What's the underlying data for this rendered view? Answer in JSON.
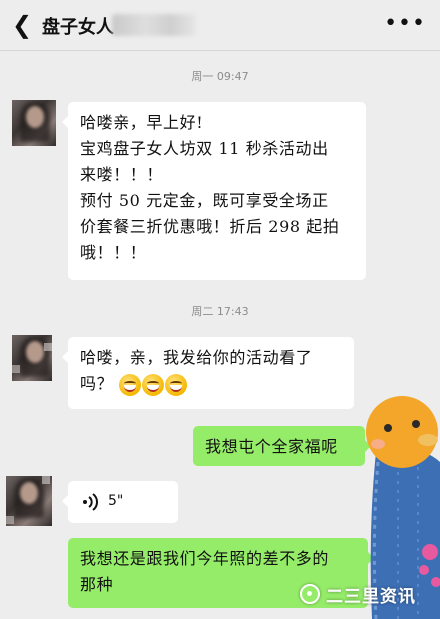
{
  "header": {
    "back_icon": "chevron-left-icon",
    "title": "盘子女人",
    "more_icon": "more-dots-icon"
  },
  "messages": {
    "ts1": "周一 09:47",
    "m1": {
      "lines": [
        "哈喽亲，早上好!",
        "宝鸡盘子女人坊双 11 秒杀活动出",
        "来喽！！！",
        "预付 50 元定金，既可享受全场正",
        "价套餐三折优惠哦！折后 298 起拍",
        "哦！！！"
      ]
    },
    "ts2": "周二 17:43",
    "m2": {
      "lines": [
        "哈喽，亲，我发给你的活动看了",
        "吗？"
      ],
      "emoji": "grinning-face-icon"
    },
    "m3": {
      "text": "我想屯个全家福呢"
    },
    "m4": {
      "duration": "5\"",
      "icon": "voice-wave-icon"
    },
    "m5": {
      "lines": [
        "我想还是跟我们今年照的差不多的",
        "那种"
      ]
    }
  },
  "watermark": {
    "text": "二三里资讯",
    "icon": "location-pin-icon"
  },
  "colors": {
    "background": "#ededed",
    "bubble_in": "#ffffff",
    "bubble_out": "#95ec69",
    "timestamp": "#8c8c8c"
  }
}
